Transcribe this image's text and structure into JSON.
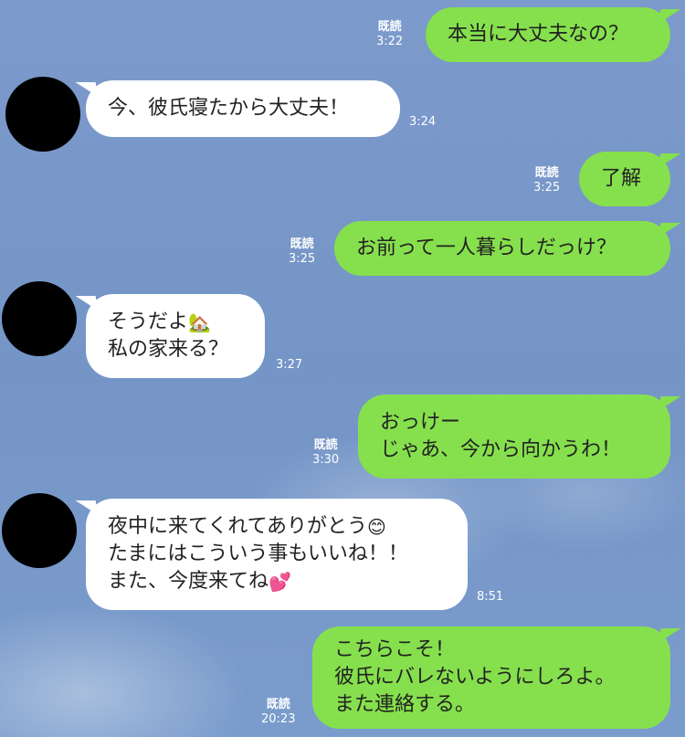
{
  "chat": {
    "messages": [
      {
        "sender": "me",
        "lines": [
          "本当に大丈夫なの？"
        ],
        "read": "既読",
        "time": "3:22"
      },
      {
        "sender": "them",
        "lines": [
          "今、彼氏寝たから大丈夫！"
        ],
        "time": "3:24"
      },
      {
        "sender": "me",
        "lines": [
          "了解"
        ],
        "read": "既読",
        "time": "3:25"
      },
      {
        "sender": "me",
        "lines": [
          "お前って一人暮らしだっけ？"
        ],
        "read": "既読",
        "time": "3:25"
      },
      {
        "sender": "them",
        "lines": [
          "そうだよ",
          "私の家来る？"
        ],
        "emoji": "🏡",
        "time": "3:27"
      },
      {
        "sender": "me",
        "lines": [
          "おっけー",
          "じゃあ、今から向かうわ！"
        ],
        "read": "既読",
        "time": "3:30"
      },
      {
        "sender": "them",
        "lines": [
          "夜中に来てくれてありがとう",
          "たまにはこういう事もいいね！！",
          "また、今度来てね"
        ],
        "emoji1": "😊",
        "emoji2": "💕",
        "time": "8:51"
      },
      {
        "sender": "me",
        "lines": [
          "こちらこそ！",
          "彼氏にバレないようにしろよ。",
          "また連絡する。"
        ],
        "read": "既読",
        "time": "20:23"
      }
    ]
  },
  "colors": {
    "me_bubble": "#86e04d",
    "them_bubble": "#ffffff",
    "background": "#7a99cb",
    "avatar": "#000000"
  }
}
